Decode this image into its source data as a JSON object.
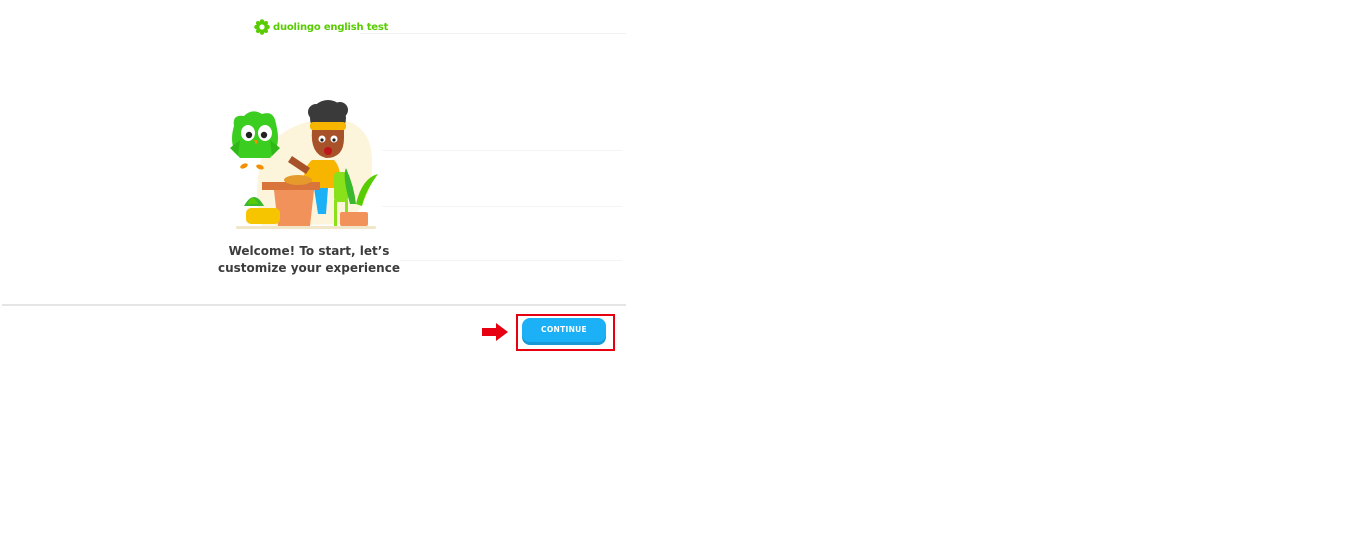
{
  "header": {
    "logo_text": "duolingo english test",
    "logo_icon": "duolingo-leaf-icon",
    "brand_color": "#58cc02"
  },
  "main": {
    "illustration_icon": "owl-and-student-illustration",
    "welcome_line1": "Welcome! To start, let’s",
    "welcome_line2": "customize your experience"
  },
  "footer": {
    "continue_label": "CONTINUE",
    "button_color": "#1cb0f6"
  },
  "annotation": {
    "arrow_icon": "red-arrow-right-icon",
    "highlight_color": "#e60012"
  }
}
